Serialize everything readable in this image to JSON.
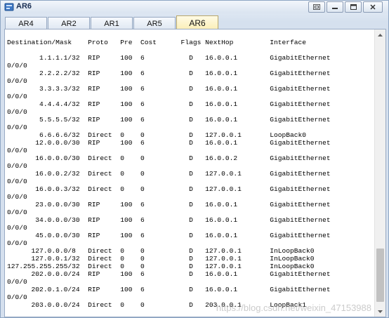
{
  "window": {
    "title": "AR6"
  },
  "tabs": [
    "AR4",
    "AR2",
    "AR1",
    "AR5",
    "AR6"
  ],
  "active_tab": "AR6",
  "watermark": "https://blog.csdn.net/weixin_47153988",
  "console_lines": [
    "Destination/Mask    Proto   Pre  Cost      Flags NextHop         Interface",
    "",
    "        1.1.1.1/32  RIP     100  6           D   16.0.0.1        GigabitEthernet",
    "0/0/0",
    "        2.2.2.2/32  RIP     100  6           D   16.0.0.1        GigabitEthernet",
    "0/0/0",
    "        3.3.3.3/32  RIP     100  6           D   16.0.0.1        GigabitEthernet",
    "0/0/0",
    "        4.4.4.4/32  RIP     100  6           D   16.0.0.1        GigabitEthernet",
    "0/0/0",
    "        5.5.5.5/32  RIP     100  6           D   16.0.0.1        GigabitEthernet",
    "0/0/0",
    "        6.6.6.6/32  Direct  0    0           D   127.0.0.1       LoopBack0",
    "       12.0.0.0/30  RIP     100  6           D   16.0.0.1        GigabitEthernet",
    "0/0/0",
    "       16.0.0.0/30  Direct  0    0           D   16.0.0.2        GigabitEthernet",
    "0/0/0",
    "       16.0.0.2/32  Direct  0    0           D   127.0.0.1       GigabitEthernet",
    "0/0/0",
    "       16.0.0.3/32  Direct  0    0           D   127.0.0.1       GigabitEthernet",
    "0/0/0",
    "       23.0.0.0/30  RIP     100  6           D   16.0.0.1        GigabitEthernet",
    "0/0/0",
    "       34.0.0.0/30  RIP     100  6           D   16.0.0.1        GigabitEthernet",
    "0/0/0",
    "       45.0.0.0/30  RIP     100  6           D   16.0.0.1        GigabitEthernet",
    "0/0/0",
    "      127.0.0.0/8   Direct  0    0           D   127.0.0.1       InLoopBack0",
    "      127.0.0.1/32  Direct  0    0           D   127.0.0.1       InLoopBack0",
    "127.255.255.255/32  Direct  0    0           D   127.0.0.1       InLoopBack0",
    "      202.0.0.0/24  RIP     100  6           D   16.0.0.1        GigabitEthernet",
    "0/0/0",
    "      202.0.1.0/24  RIP     100  6           D   16.0.0.1        GigabitEthernet",
    "0/0/0",
    "      203.0.0.0/24  Direct  0    0           D   203.0.0.1       LoopBack1"
  ]
}
